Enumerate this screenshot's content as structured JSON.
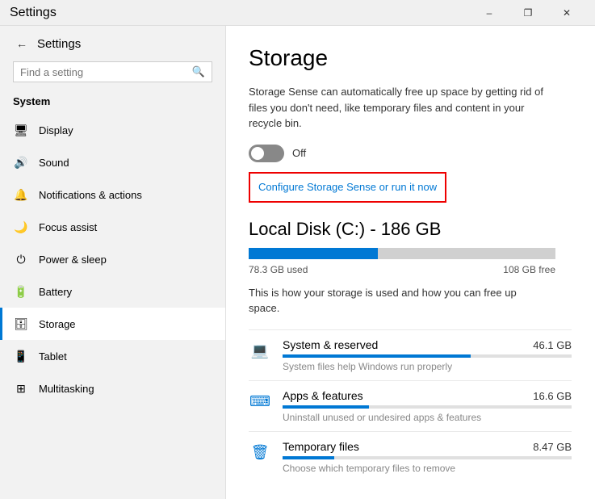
{
  "titlebar": {
    "title": "Settings",
    "minimize": "–",
    "restore": "❐",
    "close": "✕"
  },
  "sidebar": {
    "back_btn": "←",
    "app_title": "Settings",
    "search_placeholder": "Find a setting",
    "section_label": "System",
    "nav_items": [
      {
        "id": "display",
        "label": "Display",
        "icon": "🖥"
      },
      {
        "id": "sound",
        "label": "Sound",
        "icon": "🔊"
      },
      {
        "id": "notifications",
        "label": "Notifications & actions",
        "icon": "🔔"
      },
      {
        "id": "focus",
        "label": "Focus assist",
        "icon": "🌙"
      },
      {
        "id": "power",
        "label": "Power & sleep",
        "icon": "⏻"
      },
      {
        "id": "battery",
        "label": "Battery",
        "icon": "🔋"
      },
      {
        "id": "storage",
        "label": "Storage",
        "icon": "🗄",
        "active": true
      },
      {
        "id": "tablet",
        "label": "Tablet",
        "icon": "📱"
      },
      {
        "id": "multitasking",
        "label": "Multitasking",
        "icon": "⊞"
      }
    ]
  },
  "main": {
    "title": "Storage",
    "description": "Storage Sense can automatically free up space by getting rid of files you don't need, like temporary files and content in your recycle bin.",
    "toggle_state": "Off",
    "configure_link": "Configure Storage Sense or run it now",
    "disk_title": "Local Disk (C:) - 186 GB",
    "disk_used": "78.3 GB used",
    "disk_free": "108 GB free",
    "disk_percent": 42,
    "disk_usage_desc": "This is how your storage is used and how you can free up space.",
    "storage_items": [
      {
        "id": "system",
        "name": "System & reserved",
        "size": "46.1 GB",
        "desc": "System files help Windows run properly",
        "icon": "💻",
        "percent": 65
      },
      {
        "id": "apps",
        "name": "Apps & features",
        "size": "16.6 GB",
        "desc": "Uninstall unused or undesired apps & features",
        "icon": "⌨",
        "percent": 30
      },
      {
        "id": "temp",
        "name": "Temporary files",
        "size": "8.47 GB",
        "desc": "Choose which temporary files to remove",
        "icon": "🗑",
        "percent": 18
      }
    ]
  }
}
